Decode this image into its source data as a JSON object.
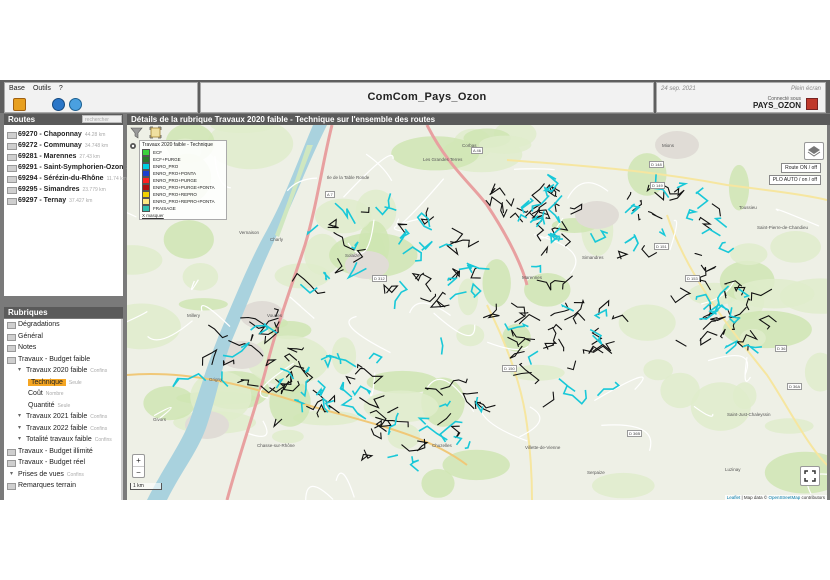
{
  "header": {
    "menu": [
      "Base",
      "Outils",
      "?"
    ],
    "app_title": "ComCom_Pays_Ozon",
    "date": "24 sep. 2021",
    "fullscreen_label": "Plein écran",
    "connected_label": "Connecté sous",
    "user": "PAYS_OZON"
  },
  "routes": {
    "title": "Routes",
    "search_placeholder": "rechercher",
    "items": [
      {
        "label": "69270 - Chaponnay",
        "length": "44.28 km"
      },
      {
        "label": "69272 - Communay",
        "length": "34.748 km"
      },
      {
        "label": "69281 - Marennes",
        "length": "27.43 km"
      },
      {
        "label": "69291 - Saint-Symphorien-Ozon",
        "length": "25.64 km"
      },
      {
        "label": "69294 - Sérézin-du-Rhône",
        "length": "11.74 km"
      },
      {
        "label": "69295 - Simandres",
        "length": "23.779 km"
      },
      {
        "label": "69297 - Ternay",
        "length": "37.427 km"
      }
    ]
  },
  "rubriques": {
    "title": "Rubriques",
    "items": [
      {
        "label": "Dégradations",
        "sub": "",
        "level": 0,
        "folder": true
      },
      {
        "label": "Général",
        "sub": "",
        "level": 0,
        "folder": true
      },
      {
        "label": "Notes",
        "sub": "",
        "level": 0,
        "folder": true
      },
      {
        "label": "Travaux - Budget faible",
        "sub": "",
        "level": 0,
        "folder": true
      },
      {
        "label": "Travaux 2020 faible",
        "sub": "Confins",
        "level": 1,
        "folder": false
      },
      {
        "label": "Technique",
        "sub": "Seule",
        "level": 2,
        "folder": false,
        "selected": true
      },
      {
        "label": "Coût",
        "sub": "Nombre",
        "level": 2,
        "folder": false
      },
      {
        "label": "Quantité",
        "sub": "Seule",
        "level": 2,
        "folder": false
      },
      {
        "label": "Travaux 2021 faible",
        "sub": "Confins",
        "level": 1,
        "folder": false
      },
      {
        "label": "Travaux 2022 faible",
        "sub": "Confins",
        "level": 1,
        "folder": false
      },
      {
        "label": "Totalité travaux faible",
        "sub": "Confins",
        "level": 1,
        "folder": false
      },
      {
        "label": "Travaux - Budget illimité",
        "sub": "",
        "level": 0,
        "folder": true
      },
      {
        "label": "Travaux - Budget réel",
        "sub": "",
        "level": 0,
        "folder": true
      },
      {
        "label": "Prises de vues",
        "sub": "Confins",
        "level": 0,
        "folder": false
      },
      {
        "label": "Remarques terrain",
        "sub": "",
        "level": 0,
        "folder": true
      }
    ]
  },
  "map": {
    "header": "Détails de la rubrique Travaux 2020 faible - Technique sur l'ensemble des routes",
    "legend_title": "Travaux 2020 faible - Technique",
    "legend": [
      {
        "label": "ECF",
        "color": "#3cd43c"
      },
      {
        "label": "ECF+PURGE",
        "color": "#2a7a2a"
      },
      {
        "label": "ENRO_PRO",
        "color": "#00cfe0"
      },
      {
        "label": "ENRO_PRO+PONTA",
        "color": "#1a3fd0"
      },
      {
        "label": "ENRO_PRO+PURGE",
        "color": "#ff2020"
      },
      {
        "label": "ENRO_PRO+PURGE+PONTA",
        "color": "#b01010"
      },
      {
        "label": "ENRO_PRO+REPRO",
        "color": "#f0d000"
      },
      {
        "label": "ENRO_PRO+REPRO+PONTA",
        "color": "#ffe880"
      },
      {
        "label": "FRAISAGE",
        "color": "#30c0b0"
      }
    ],
    "legend_link": "X masquer",
    "route_btn": "Route ON / off",
    "plo_btn": "PLO AUTO / on / off",
    "zoom_in": "+",
    "zoom_out": "−",
    "scale": "1 km",
    "attribution": {
      "leaflet": "Leaflet",
      "text": " | Map data © ",
      "osm": "OpenStreetMap",
      "suffix": " contributors"
    },
    "places": [
      {
        "name": "Corbas"
      },
      {
        "name": "Mions"
      },
      {
        "name": "Les Grandes Terres"
      },
      {
        "name": "Saint-Pierre-de-Chandieu"
      },
      {
        "name": "Toussieu"
      },
      {
        "name": "Vernaison"
      },
      {
        "name": "Charly"
      },
      {
        "name": "Millery"
      },
      {
        "name": "Grigny"
      },
      {
        "name": "Givors"
      },
      {
        "name": "Chuzelles"
      },
      {
        "name": "Villette-de-Vienne"
      },
      {
        "name": "Luzinay"
      },
      {
        "name": "Saint-Just-Chaleyssin"
      },
      {
        "name": "Serpaize"
      },
      {
        "name": "Chasse-sur-Rhône"
      },
      {
        "name": "Solaize"
      },
      {
        "name": "Ile de la Table Ronde"
      },
      {
        "name": "Vourles"
      },
      {
        "name": "Marennes"
      },
      {
        "name": "Simandres"
      }
    ],
    "roads": [
      "A 7",
      "A 46",
      "D 149",
      "D 148",
      "D 36",
      "D 151",
      "D 36A",
      "D 36B",
      "D 312",
      "D 150",
      "D 153"
    ]
  },
  "colors": {
    "chrome": "#5f5f5f",
    "panel_bg": "#ffffff",
    "selected": "#f5a623",
    "accent": "#0078a8"
  }
}
